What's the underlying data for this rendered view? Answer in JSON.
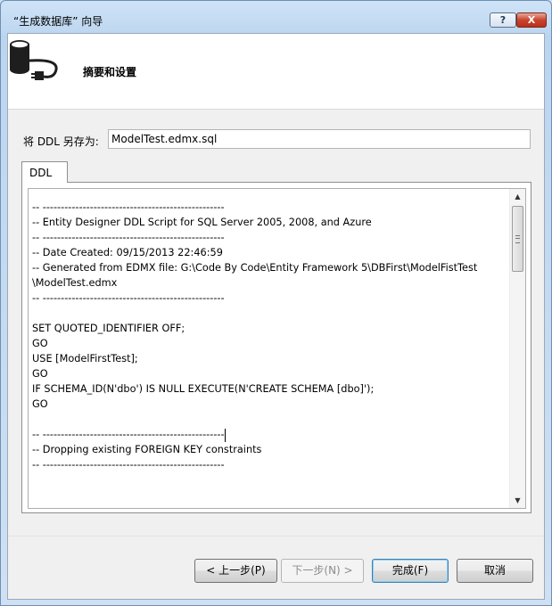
{
  "window": {
    "title": "“生成数据库” 向导",
    "help_button": "?",
    "close_button": "X"
  },
  "header": {
    "icon": "database-connection-icon",
    "title": "摘要和设置"
  },
  "save_as": {
    "label": "将 DDL 另存为:",
    "value": "ModelTest.edmx.sql"
  },
  "tabs": [
    {
      "label": "DDL",
      "selected": true
    }
  ],
  "ddl": {
    "lines": [
      "-- --------------------------------------------------",
      "-- Entity Designer DDL Script for SQL Server 2005, 2008, and Azure",
      "-- --------------------------------------------------",
      "-- Date Created: 09/15/2013 22:46:59",
      "-- Generated from EDMX file: G:\\Code By Code\\Entity Framework 5\\DBFirst\\ModelFistTest",
      "\\ModelTest.edmx",
      "-- --------------------------------------------------",
      "",
      "SET QUOTED_IDENTIFIER OFF;",
      "GO",
      "USE [ModelFirstTest];",
      "GO",
      "IF SCHEMA_ID(N'dbo') IS NULL EXECUTE(N'CREATE SCHEMA [dbo]');",
      "GO",
      "",
      "-- --------------------------------------------------",
      "-- Dropping existing FOREIGN KEY constraints",
      "-- --------------------------------------------------"
    ]
  },
  "buttons": {
    "prev": "< 上一步(P)",
    "next": "下一步(N) >",
    "finish": "完成(F)",
    "cancel": "取消"
  },
  "states": {
    "next_enabled": false,
    "default_button": "finish"
  },
  "colors": {
    "title_gradient_top": "#cfe3f7",
    "close_button": "#c9452f",
    "default_button_border": "#3c7fb1"
  }
}
